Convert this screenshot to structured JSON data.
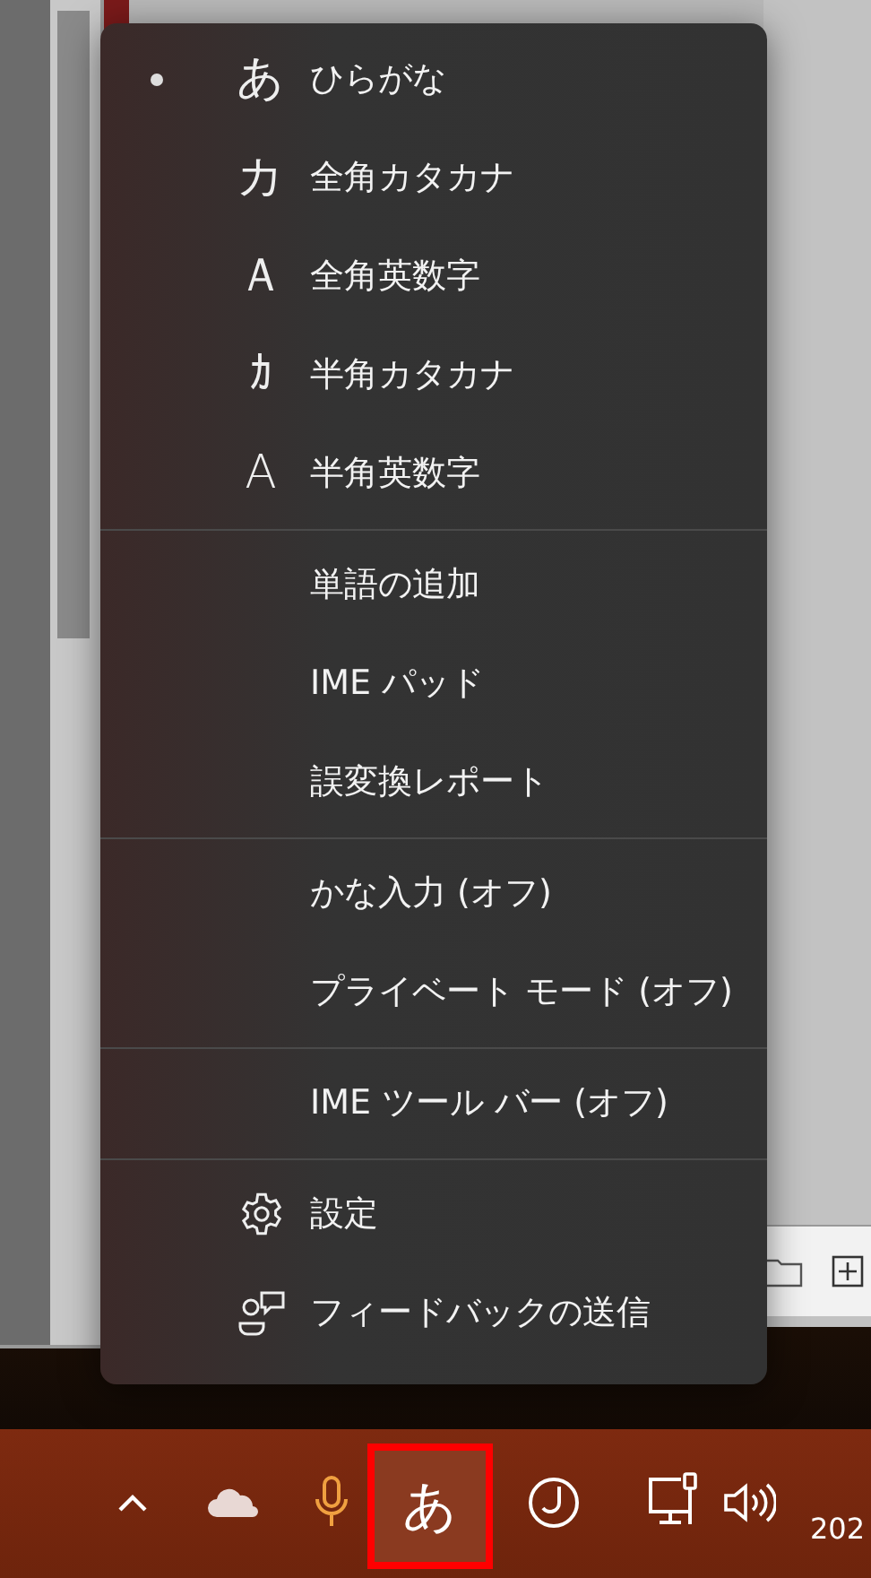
{
  "menu": {
    "groups": [
      {
        "items": [
          {
            "kind": "mode",
            "glyph": "あ",
            "label": "ひらがな",
            "selected": true
          },
          {
            "kind": "mode",
            "glyph": "カ",
            "label": "全角カタカナ",
            "selected": false
          },
          {
            "kind": "mode",
            "glyph": "Ａ",
            "label": "全角英数字",
            "selected": false
          },
          {
            "kind": "mode",
            "glyph": "ｶ",
            "label": "半角カタカナ",
            "selected": false
          },
          {
            "kind": "mode",
            "glyph": "A",
            "label": "半角英数字",
            "selected": false
          }
        ]
      },
      {
        "items": [
          {
            "kind": "plain",
            "label": "単語の追加"
          },
          {
            "kind": "plain",
            "label": "IME パッド"
          },
          {
            "kind": "plain",
            "label": "誤変換レポート"
          }
        ]
      },
      {
        "items": [
          {
            "kind": "plain",
            "label": "かな入力 (オフ)"
          },
          {
            "kind": "plain",
            "label": "プライベート モード (オフ)"
          }
        ]
      },
      {
        "items": [
          {
            "kind": "plain",
            "label": "IME ツール バー (オフ)"
          }
        ]
      },
      {
        "items": [
          {
            "kind": "settings",
            "label": "設定"
          },
          {
            "kind": "feedback",
            "label": "フィードバックの送信"
          }
        ]
      }
    ]
  },
  "taskbar": {
    "ime_button": {
      "label": "あ",
      "highlighted": true
    },
    "clock": "202"
  }
}
